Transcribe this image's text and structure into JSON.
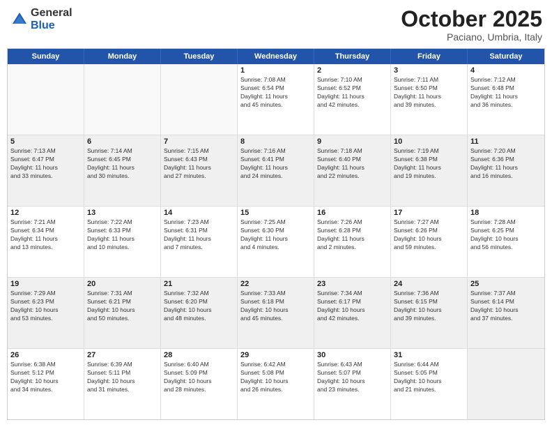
{
  "logo": {
    "general": "General",
    "blue": "Blue"
  },
  "title": "October 2025",
  "subtitle": "Paciano, Umbria, Italy",
  "weekdays": [
    "Sunday",
    "Monday",
    "Tuesday",
    "Wednesday",
    "Thursday",
    "Friday",
    "Saturday"
  ],
  "rows": [
    [
      {
        "day": "",
        "info": ""
      },
      {
        "day": "",
        "info": ""
      },
      {
        "day": "",
        "info": ""
      },
      {
        "day": "1",
        "info": "Sunrise: 7:08 AM\nSunset: 6:54 PM\nDaylight: 11 hours\nand 45 minutes."
      },
      {
        "day": "2",
        "info": "Sunrise: 7:10 AM\nSunset: 6:52 PM\nDaylight: 11 hours\nand 42 minutes."
      },
      {
        "day": "3",
        "info": "Sunrise: 7:11 AM\nSunset: 6:50 PM\nDaylight: 11 hours\nand 39 minutes."
      },
      {
        "day": "4",
        "info": "Sunrise: 7:12 AM\nSunset: 6:48 PM\nDaylight: 11 hours\nand 36 minutes."
      }
    ],
    [
      {
        "day": "5",
        "info": "Sunrise: 7:13 AM\nSunset: 6:47 PM\nDaylight: 11 hours\nand 33 minutes."
      },
      {
        "day": "6",
        "info": "Sunrise: 7:14 AM\nSunset: 6:45 PM\nDaylight: 11 hours\nand 30 minutes."
      },
      {
        "day": "7",
        "info": "Sunrise: 7:15 AM\nSunset: 6:43 PM\nDaylight: 11 hours\nand 27 minutes."
      },
      {
        "day": "8",
        "info": "Sunrise: 7:16 AM\nSunset: 6:41 PM\nDaylight: 11 hours\nand 24 minutes."
      },
      {
        "day": "9",
        "info": "Sunrise: 7:18 AM\nSunset: 6:40 PM\nDaylight: 11 hours\nand 22 minutes."
      },
      {
        "day": "10",
        "info": "Sunrise: 7:19 AM\nSunset: 6:38 PM\nDaylight: 11 hours\nand 19 minutes."
      },
      {
        "day": "11",
        "info": "Sunrise: 7:20 AM\nSunset: 6:36 PM\nDaylight: 11 hours\nand 16 minutes."
      }
    ],
    [
      {
        "day": "12",
        "info": "Sunrise: 7:21 AM\nSunset: 6:34 PM\nDaylight: 11 hours\nand 13 minutes."
      },
      {
        "day": "13",
        "info": "Sunrise: 7:22 AM\nSunset: 6:33 PM\nDaylight: 11 hours\nand 10 minutes."
      },
      {
        "day": "14",
        "info": "Sunrise: 7:23 AM\nSunset: 6:31 PM\nDaylight: 11 hours\nand 7 minutes."
      },
      {
        "day": "15",
        "info": "Sunrise: 7:25 AM\nSunset: 6:30 PM\nDaylight: 11 hours\nand 4 minutes."
      },
      {
        "day": "16",
        "info": "Sunrise: 7:26 AM\nSunset: 6:28 PM\nDaylight: 11 hours\nand 2 minutes."
      },
      {
        "day": "17",
        "info": "Sunrise: 7:27 AM\nSunset: 6:26 PM\nDaylight: 10 hours\nand 59 minutes."
      },
      {
        "day": "18",
        "info": "Sunrise: 7:28 AM\nSunset: 6:25 PM\nDaylight: 10 hours\nand 56 minutes."
      }
    ],
    [
      {
        "day": "19",
        "info": "Sunrise: 7:29 AM\nSunset: 6:23 PM\nDaylight: 10 hours\nand 53 minutes."
      },
      {
        "day": "20",
        "info": "Sunrise: 7:31 AM\nSunset: 6:21 PM\nDaylight: 10 hours\nand 50 minutes."
      },
      {
        "day": "21",
        "info": "Sunrise: 7:32 AM\nSunset: 6:20 PM\nDaylight: 10 hours\nand 48 minutes."
      },
      {
        "day": "22",
        "info": "Sunrise: 7:33 AM\nSunset: 6:18 PM\nDaylight: 10 hours\nand 45 minutes."
      },
      {
        "day": "23",
        "info": "Sunrise: 7:34 AM\nSunset: 6:17 PM\nDaylight: 10 hours\nand 42 minutes."
      },
      {
        "day": "24",
        "info": "Sunrise: 7:36 AM\nSunset: 6:15 PM\nDaylight: 10 hours\nand 39 minutes."
      },
      {
        "day": "25",
        "info": "Sunrise: 7:37 AM\nSunset: 6:14 PM\nDaylight: 10 hours\nand 37 minutes."
      }
    ],
    [
      {
        "day": "26",
        "info": "Sunrise: 6:38 AM\nSunset: 5:12 PM\nDaylight: 10 hours\nand 34 minutes."
      },
      {
        "day": "27",
        "info": "Sunrise: 6:39 AM\nSunset: 5:11 PM\nDaylight: 10 hours\nand 31 minutes."
      },
      {
        "day": "28",
        "info": "Sunrise: 6:40 AM\nSunset: 5:09 PM\nDaylight: 10 hours\nand 28 minutes."
      },
      {
        "day": "29",
        "info": "Sunrise: 6:42 AM\nSunset: 5:08 PM\nDaylight: 10 hours\nand 26 minutes."
      },
      {
        "day": "30",
        "info": "Sunrise: 6:43 AM\nSunset: 5:07 PM\nDaylight: 10 hours\nand 23 minutes."
      },
      {
        "day": "31",
        "info": "Sunrise: 6:44 AM\nSunset: 5:05 PM\nDaylight: 10 hours\nand 21 minutes."
      },
      {
        "day": "",
        "info": ""
      }
    ]
  ]
}
